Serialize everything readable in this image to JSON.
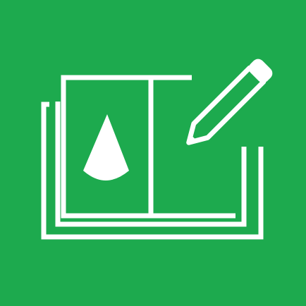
{
  "app_icon": {
    "icon_name": "notebook-cone-pencil-icon",
    "background_color": "#1DAA4E",
    "foreground_color": "#FFFFFF"
  }
}
